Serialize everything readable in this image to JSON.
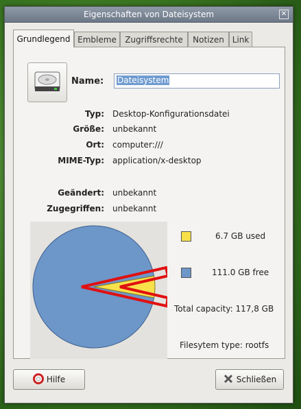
{
  "window": {
    "title": "Eigenschaften von Dateisystem",
    "close_glyph": "✕"
  },
  "tabs": [
    {
      "label": "Grundlegend",
      "active": true
    },
    {
      "label": "Embleme"
    },
    {
      "label": "Zugriffsrechte"
    },
    {
      "label": "Notizen"
    },
    {
      "label": "Link"
    }
  ],
  "name": {
    "label": "Name:",
    "value": "Dateisystem"
  },
  "properties": [
    {
      "label": "Typ:",
      "value": "Desktop-Konfigurationsdatei"
    },
    {
      "label": "Größe:",
      "value": "unbekannt"
    },
    {
      "label": "Ort:",
      "value": "computer:///"
    },
    {
      "label": "MIME-Typ:",
      "value": "application/x-desktop"
    },
    {
      "label": "Geändert:",
      "value": "unbekannt"
    },
    {
      "label": "Zugegriffen:",
      "value": "unbekannt"
    }
  ],
  "usage": {
    "used_label": "6.7 GB used",
    "free_label": "111.0 GB free",
    "total_label": "Total capacity: 117,8 GB",
    "fs_label": "Filesytem type: rootfs",
    "used_gb": 6.7,
    "free_gb": 111.0,
    "used_color": "#f7e04a",
    "free_color": "#6d96c9",
    "highlight_color": "#e01010"
  },
  "buttons": {
    "help_label": "Hilfe",
    "help_icon": "help-lifebuoy-icon",
    "close_label": "Schließen",
    "close_icon": "close-x-icon"
  }
}
